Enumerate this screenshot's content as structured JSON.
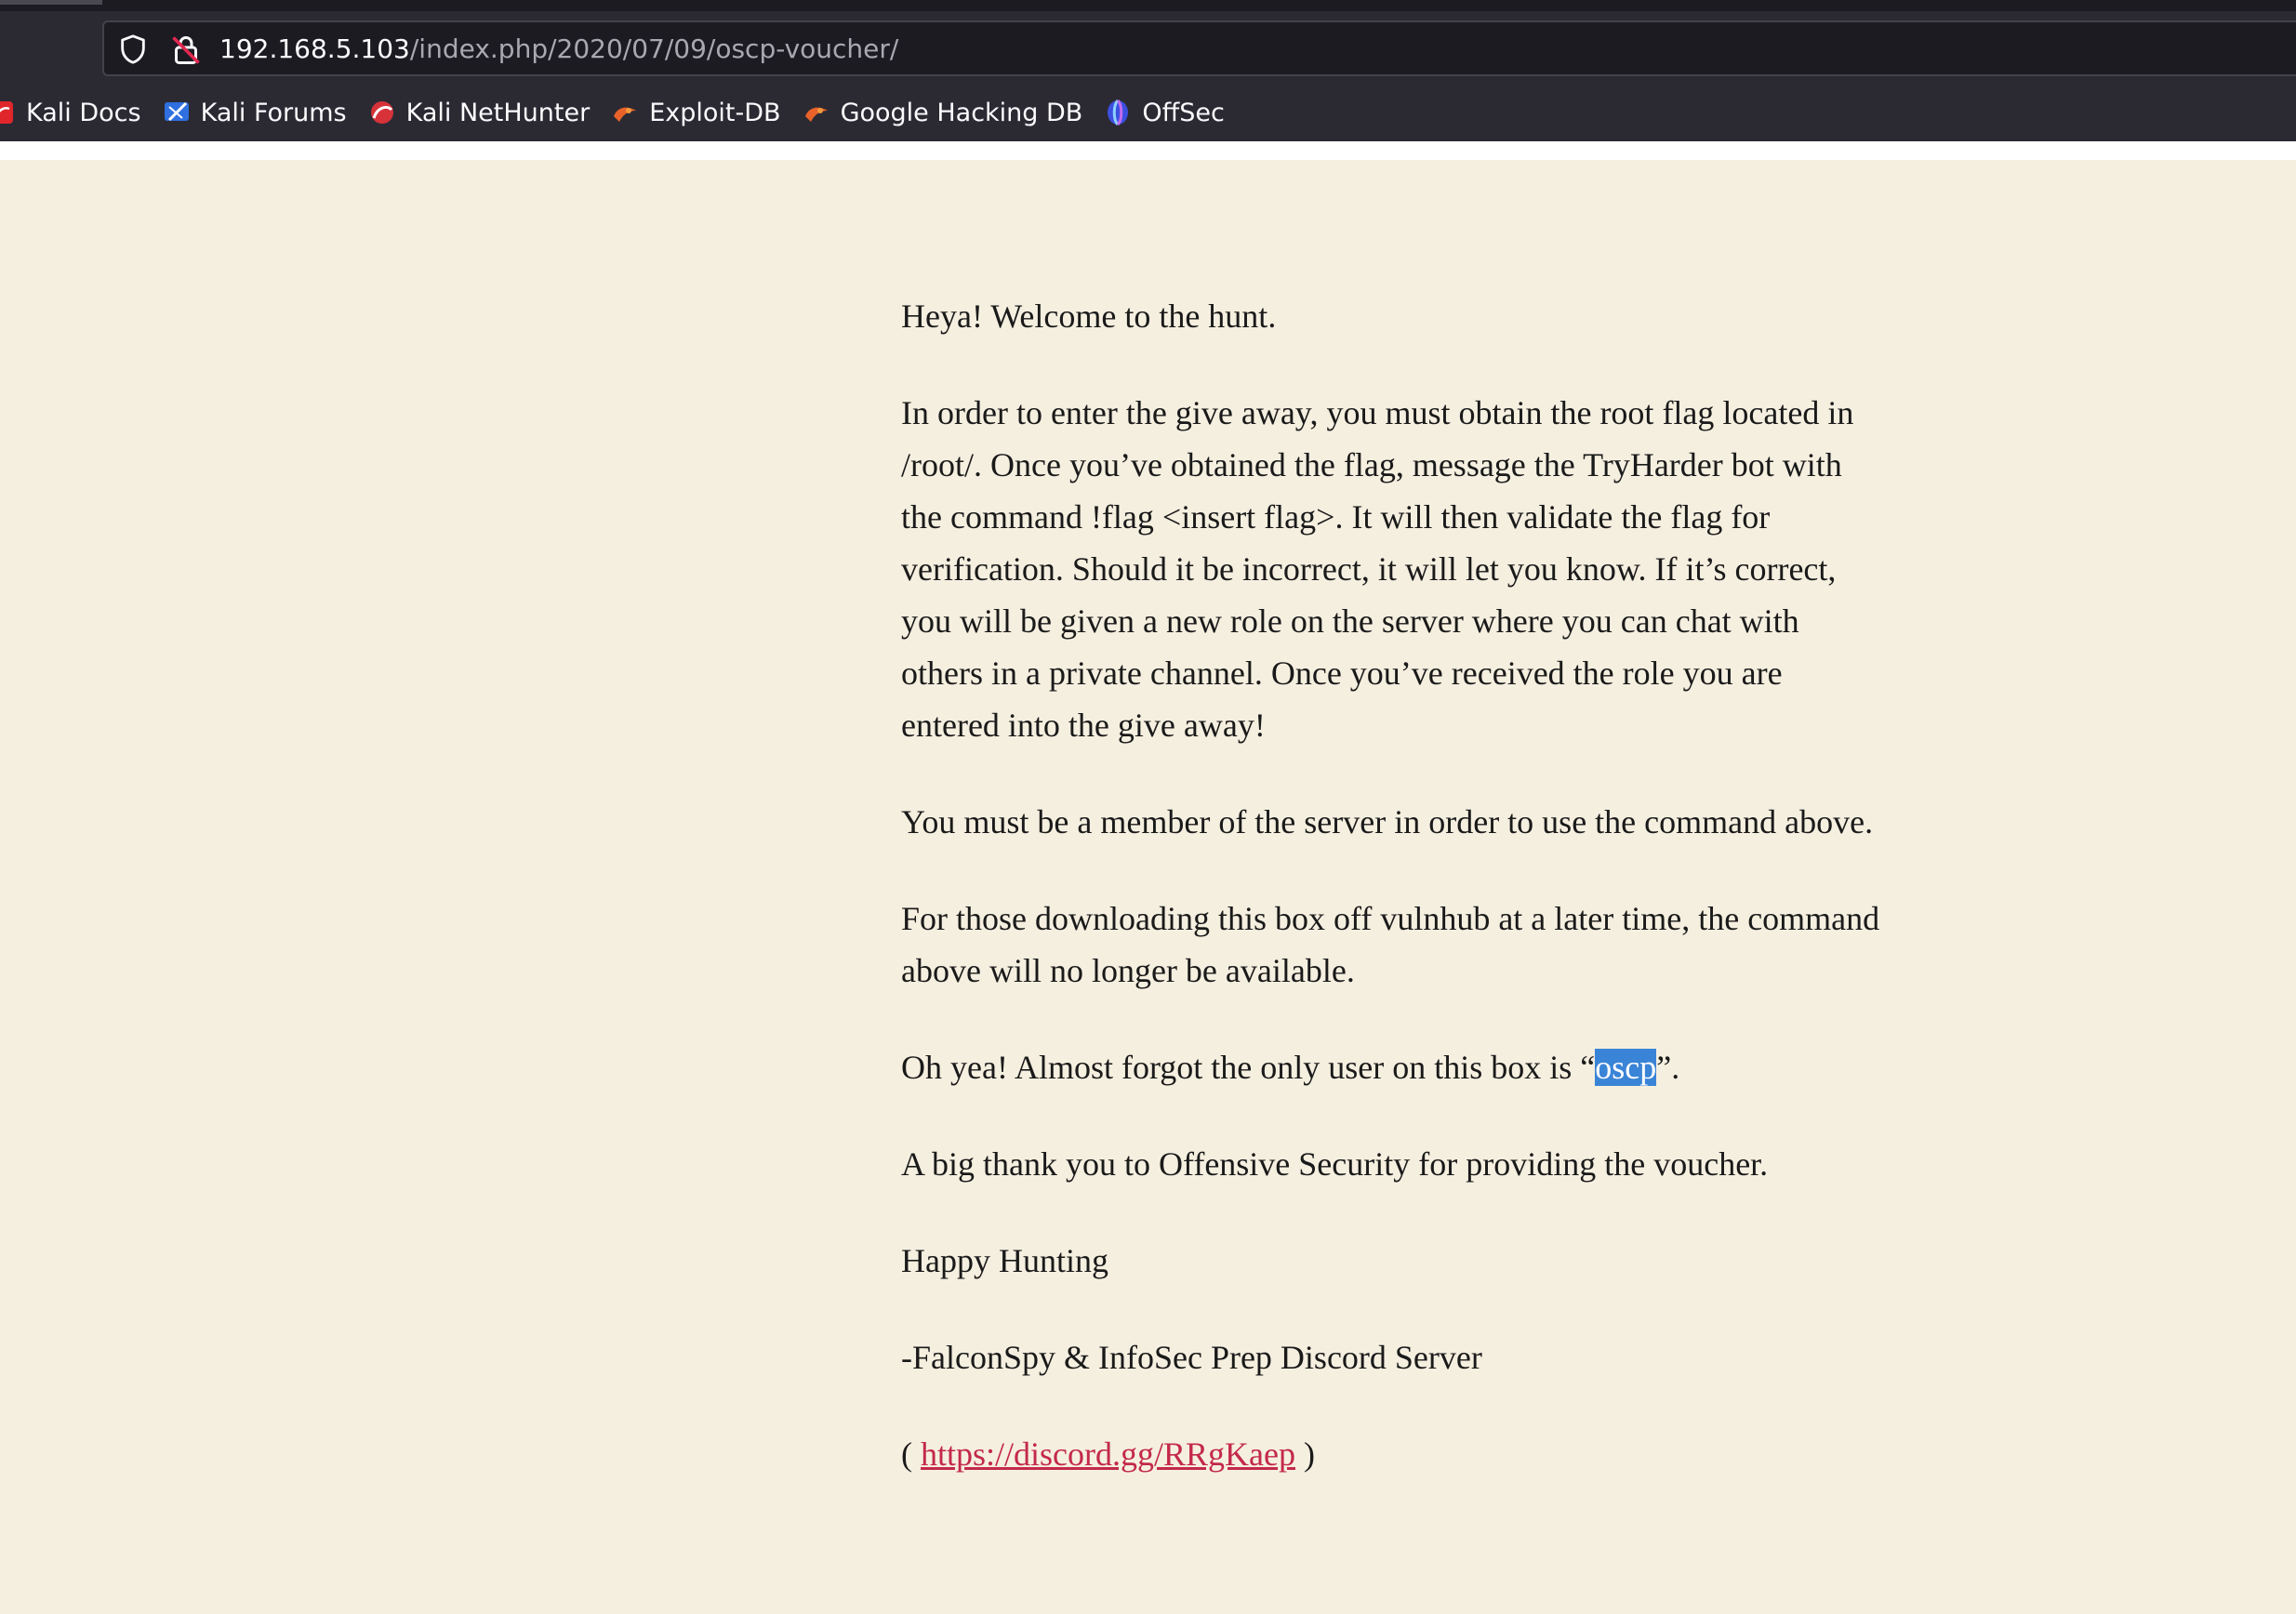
{
  "browser": {
    "url_host": "192.168.5.103",
    "url_path": "/index.php/2020/07/09/oscp-voucher/",
    "bookmarks": [
      {
        "label": "Kali Docs",
        "icon": "kali-docs-icon"
      },
      {
        "label": "Kali Forums",
        "icon": "kali-forums-icon"
      },
      {
        "label": "Kali NetHunter",
        "icon": "kali-nethunter-icon"
      },
      {
        "label": "Exploit-DB",
        "icon": "exploit-db-icon"
      },
      {
        "label": "Google Hacking DB",
        "icon": "google-hacking-db-icon"
      },
      {
        "label": "OffSec",
        "icon": "offsec-icon"
      }
    ]
  },
  "colors": {
    "page_background": "#f5efe0",
    "chrome_background": "#2b2a33",
    "selection_highlight": "#3a84d7",
    "link": "#c3294b"
  },
  "post": {
    "greeting": "Heya! Welcome to the hunt.",
    "instructions": "In order to enter the give away, you must obtain the root flag located in /root/. Once you’ve obtained the flag, message the TryHarder bot with the command !flag <insert flag>. It will then validate the flag for verification. Should it be incorrect, it will let you know. If it’s correct, you will be given a new role on the server where you can chat with others in a private channel. Once you’ve received the role you are entered into the give away!",
    "membership_note": "You must be a member of the server in order to use the command above.",
    "vulnhub_note": "For those downloading this box off vulnhub at a later time, the command above will no longer be available.",
    "user_note_before": "Oh yea! Almost forgot the only user on this box is “",
    "user_name": "oscp",
    "user_note_after": "”.",
    "thanks": "A big thank you to Offensive Security for providing the voucher.",
    "closing": "Happy Hunting",
    "signature": "-FalconSpy & InfoSec Prep Discord Server",
    "link_open": "( ",
    "link_text": "https://discord.gg/RRgKaep",
    "link_close": " )"
  }
}
